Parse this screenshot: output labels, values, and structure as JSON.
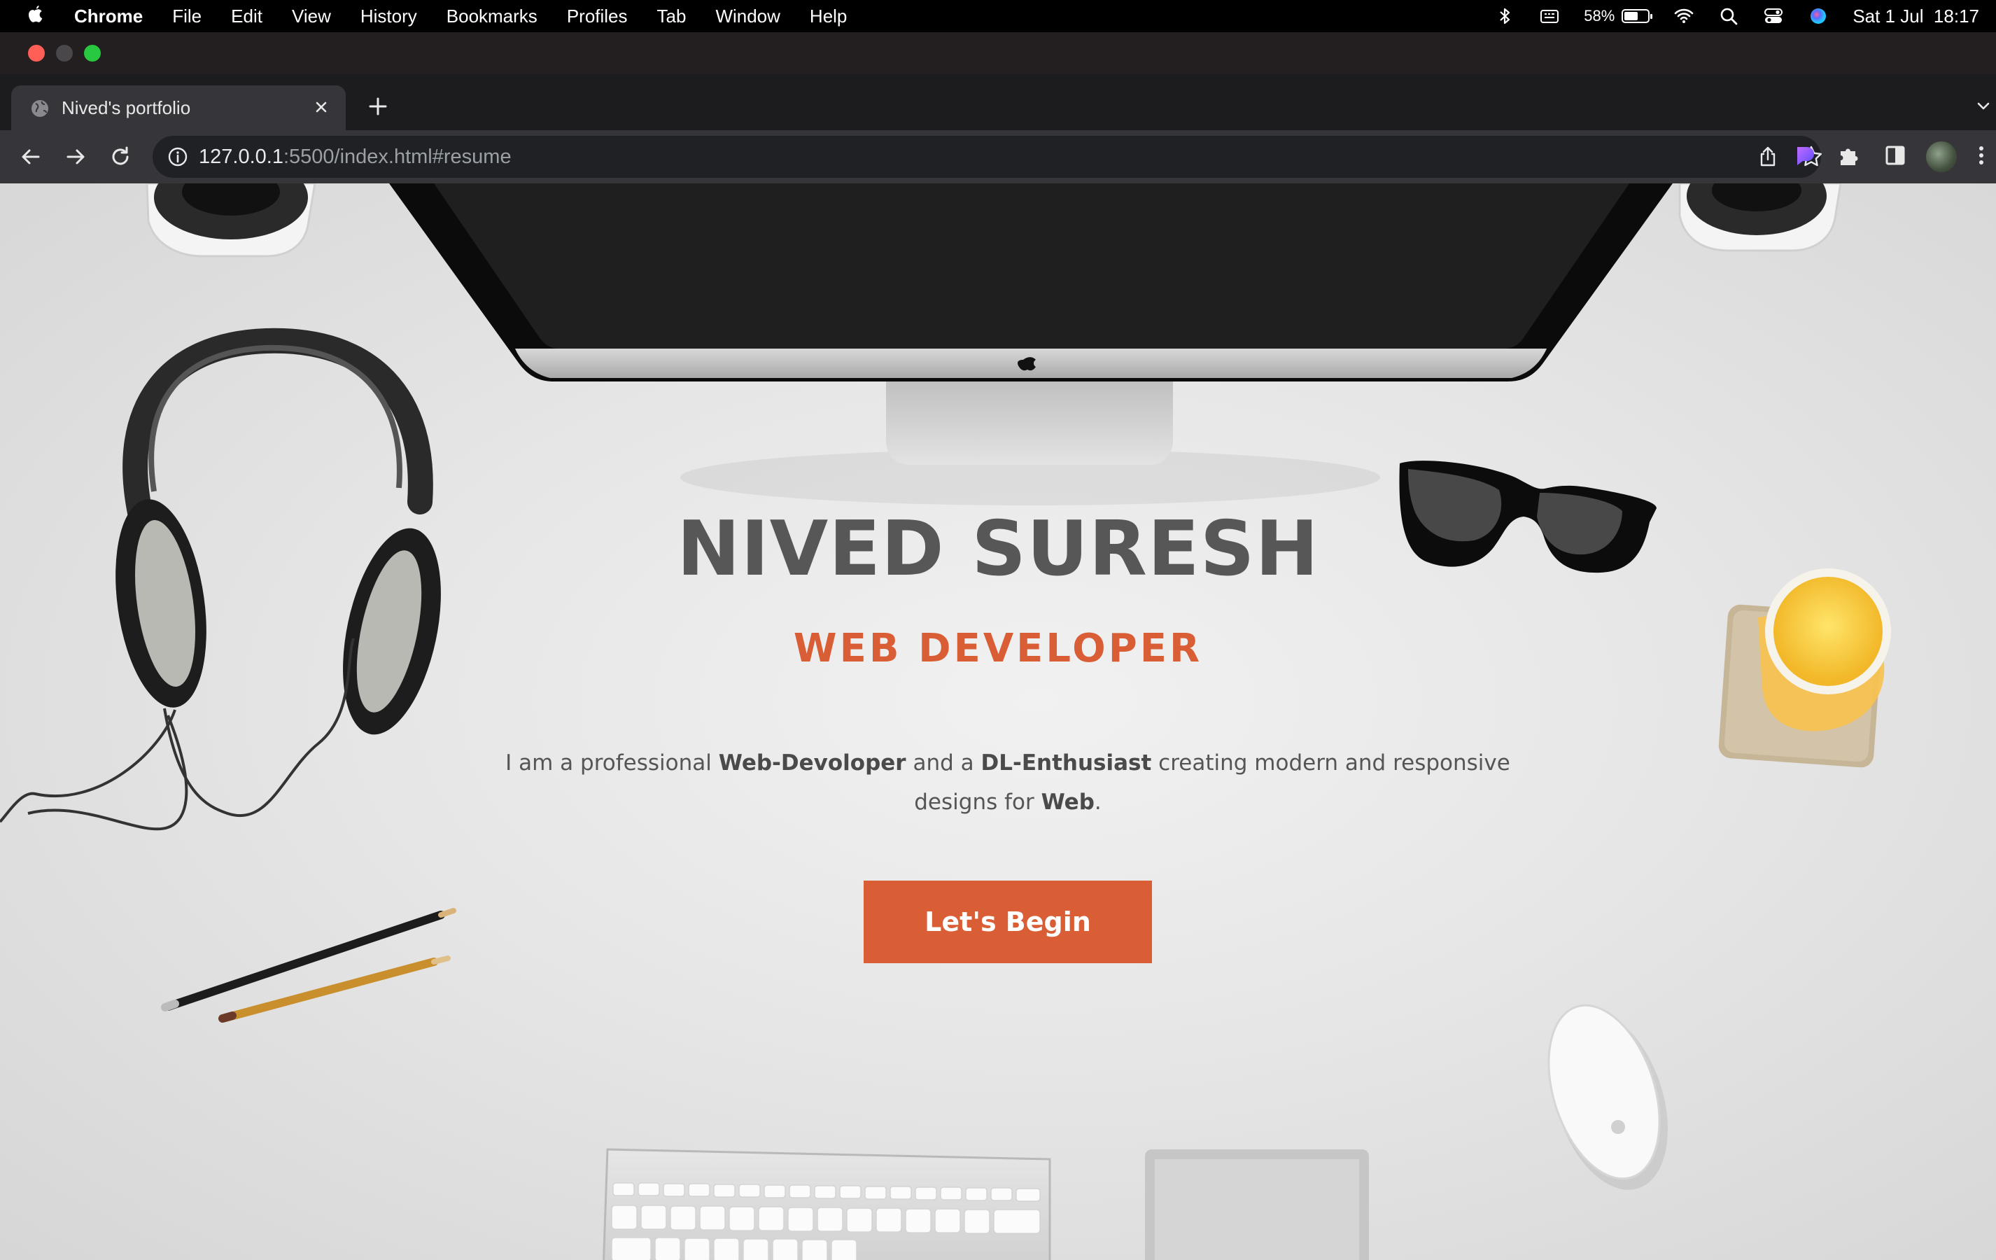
{
  "menubar": {
    "app": "Chrome",
    "menus": [
      "File",
      "Edit",
      "View",
      "History",
      "Bookmarks",
      "Profiles",
      "Tab",
      "Window",
      "Help"
    ],
    "battery_percent": "58%",
    "battery_level": 0.58,
    "clock": "Sat 1 Jul  18:17"
  },
  "browser": {
    "tab_title": "Nived's portfolio",
    "url_host": "127.0.0.1",
    "url_rest": ":5500/index.html#resume"
  },
  "hero": {
    "name": "NIVED SURESH",
    "role": "WEB DEVELOPER",
    "desc_1": "I am a professional ",
    "desc_bold_1": "Web-Devoloper",
    "desc_2": " and a ",
    "desc_bold_2": "DL-Enthusiast",
    "desc_3": " creating modern and responsive designs for ",
    "desc_bold_3": "Web",
    "desc_4": ".",
    "cta_label": "Let's Begin"
  },
  "colors": {
    "accent": "#d95e35",
    "heading": "#575757",
    "menubar_bg": "#000000",
    "toolbar_bg": "#36363a"
  },
  "icons": [
    "apple-logo-icon",
    "bluetooth-icon",
    "keyboard-input-icon",
    "battery-icon",
    "wifi-icon",
    "spotlight-search-icon",
    "control-center-icon",
    "siri-icon",
    "globe-icon",
    "close-icon",
    "plus-icon",
    "chevron-down-icon",
    "back-arrow-icon",
    "forward-arrow-icon",
    "reload-icon",
    "info-icon",
    "share-icon",
    "star-icon",
    "extension-icon",
    "puzzle-icon",
    "side-panel-icon",
    "kebab-menu-icon"
  ]
}
